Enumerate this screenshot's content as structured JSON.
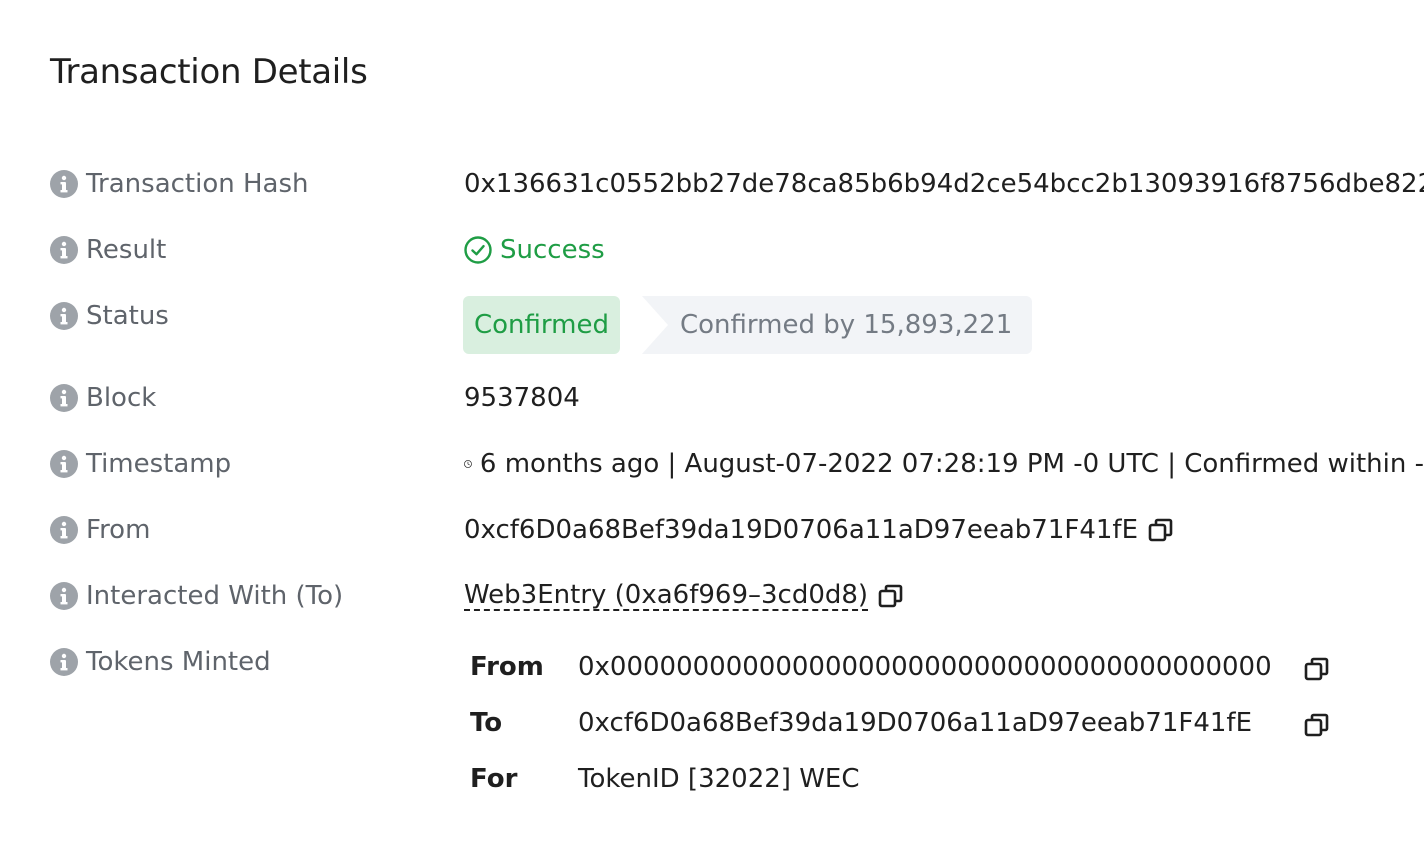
{
  "page": {
    "title": "Transaction Details"
  },
  "labels": {
    "tx_hash": "Transaction Hash",
    "result": "Result",
    "status": "Status",
    "block": "Block",
    "timestamp": "Timestamp",
    "from": "From",
    "interacted_with": "Interacted With (To)",
    "tokens_minted": "Tokens Minted"
  },
  "values": {
    "tx_hash": "0x136631c0552bb27de78ca85b6b94d2ce54bcc2b13093916f8756dbe822",
    "result": "Success",
    "status_badge": "Confirmed",
    "confirmations": "Confirmed by 15,893,221",
    "block": "9537804",
    "timestamp": "6 months ago | August-07-2022 07:28:19 PM -0 UTC | Confirmed within -",
    "from": "0xcf6D0a68Bef39da19D0706a11aD97eeab71F41fE",
    "interacted_with": "Web3Entry (0xa6f969–3cd0d8)"
  },
  "tokens_minted": {
    "from_label": "From",
    "from_value": "0x0000000000000000000000000000000000000000",
    "to_label": "To",
    "to_value": "0xcf6D0a68Bef39da19D0706a11aD97eeab71F41fE",
    "for_label": "For",
    "for_value": "TokenID [32022] WEC"
  },
  "colors": {
    "success": "#1f9d45",
    "success_bg": "#d9efdf",
    "muted_bg": "#f2f4f7",
    "label_text": "#5f646b",
    "icon_gray": "#9ea3a9"
  },
  "icons": {
    "info": "info-icon",
    "success": "check-circle-icon",
    "timestamp": "clock-icon",
    "copy": "copy-icon"
  }
}
